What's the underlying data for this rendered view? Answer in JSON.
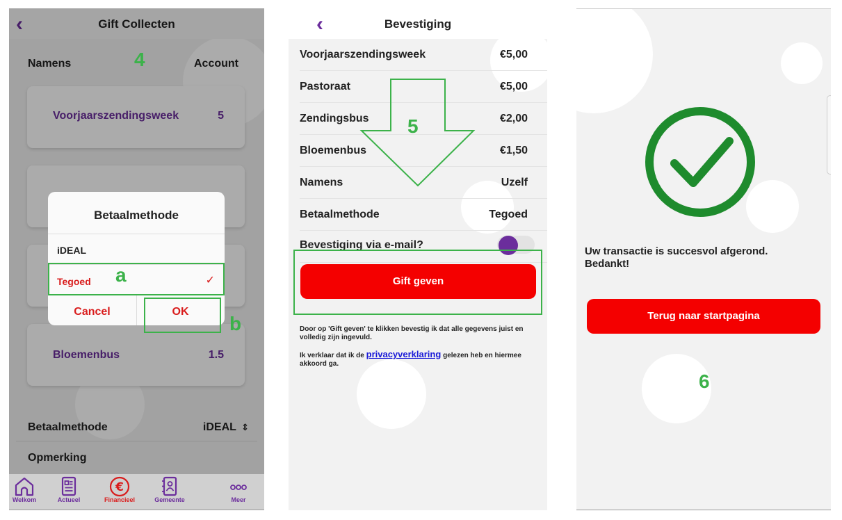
{
  "screen1": {
    "title": "Gift Collecten",
    "namens_label": "Namens",
    "account_label": "Account",
    "cards": [
      {
        "name": "Voorjaarszendingsweek",
        "value": "5"
      },
      {
        "name": "Bloemenbus",
        "value": "1.5"
      }
    ],
    "dialog": {
      "title": "Betaalmethode",
      "options": [
        "iDEAL",
        "Tegoed"
      ],
      "selected": "Tegoed",
      "cancel": "Cancel",
      "ok": "OK"
    },
    "betaalmethode_label": "Betaalmethode",
    "betaalmethode_value": "iDEAL",
    "opmerking_label": "Opmerking",
    "tabs": [
      {
        "label": "Welkom",
        "icon": "home-icon"
      },
      {
        "label": "Actueel",
        "icon": "news-icon"
      },
      {
        "label": "Financieel",
        "icon": "euro-icon"
      },
      {
        "label": "Gemeente",
        "icon": "contacts-icon"
      },
      {
        "label": "Meer",
        "icon": "more-icon"
      }
    ]
  },
  "screen2": {
    "title": "Bevestiging",
    "rows": [
      {
        "label": "Voorjaarszendingsweek",
        "value": "€5,00"
      },
      {
        "label": "Pastoraat",
        "value": "€5,00"
      },
      {
        "label": "Zendingsbus",
        "value": "€2,00"
      },
      {
        "label": "Bloemenbus",
        "value": "€1,50"
      },
      {
        "label": "Namens",
        "value": "Uzelf"
      },
      {
        "label": "Betaalmethode",
        "value": "Tegoed"
      }
    ],
    "email_label": "Bevestiging via e-mail?",
    "email_toggle_on": true,
    "gift_button": "Gift geven",
    "disclaimer1": "Door op 'Gift geven' te klikken bevestig ik dat alle gegevens juist en volledig zijn ingevuld.",
    "disclaimer2_pre": "Ik verklaar dat ik de ",
    "disclaimer2_link": "privacyverklaring",
    "disclaimer2_post": " gelezen heb en hiermee akkoord ga."
  },
  "screen3": {
    "message": "Uw transactie is succesvol afgerond. Bedankt!",
    "button": "Terug naar startpagina"
  },
  "annotations": {
    "step4": "4",
    "step5": "5",
    "step6": "6",
    "a": "a",
    "b": "b"
  },
  "colors": {
    "purple": "#6b2d9c",
    "red": "#f40000",
    "green_check": "#1e8b2d",
    "annotation_green": "#3cb24a"
  }
}
